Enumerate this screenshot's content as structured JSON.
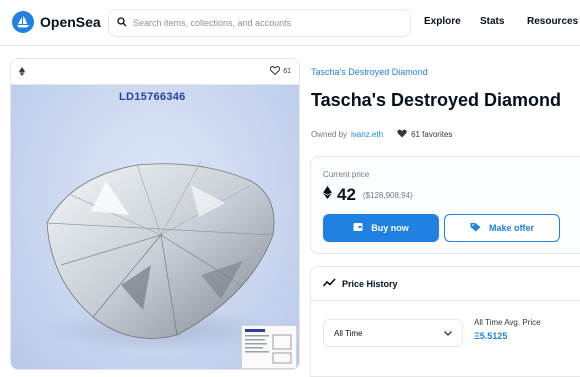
{
  "header": {
    "logo_text": "OpenSea",
    "search_placeholder": "Search items, collections, and accounts",
    "nav": [
      "Explore",
      "Stats",
      "Resources"
    ]
  },
  "item_panel": {
    "favorite_count": "61",
    "lot_number": "LD15766346"
  },
  "details": {
    "collection": "Tascha's Destroyed Diamond",
    "title": "Tascha's Destroyed Diamond",
    "owned_by_label": "Owned by",
    "owner": "ivanz.eth",
    "favorites": "61 favorites"
  },
  "price": {
    "label": "Current price",
    "eth": "42",
    "usd": "($128,908.94)",
    "buy_label": "Buy now",
    "offer_label": "Make offer"
  },
  "history": {
    "title": "Price History",
    "range_selected": "All Time",
    "avg_label": "All Time Avg. Price",
    "avg_value": "Ξ5.5125"
  },
  "colors": {
    "accent": "#2081e2",
    "text": "#04111d",
    "muted": "#707a83"
  }
}
